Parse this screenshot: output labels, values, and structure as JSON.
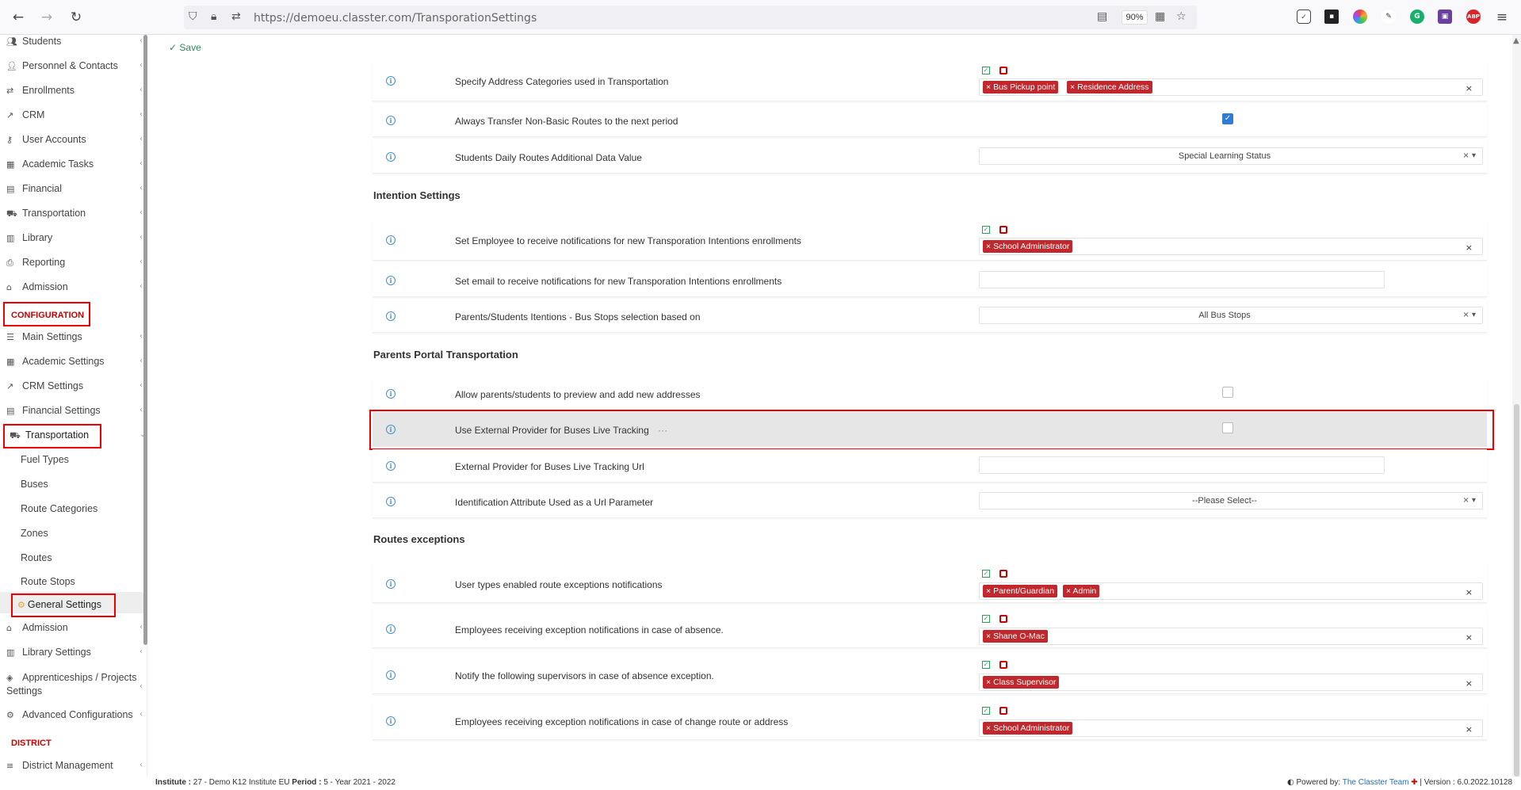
{
  "browser": {
    "url": "https://demoeu.classter.com/TransporationSettings",
    "zoom": "90%"
  },
  "sidebar": {
    "items": [
      {
        "label": "Students",
        "icon": "students-icon"
      },
      {
        "label": "Personnel & Contacts",
        "icon": "personnel-icon"
      },
      {
        "label": "Enrollments",
        "icon": "enrollments-icon"
      },
      {
        "label": "CRM",
        "icon": "crm-icon"
      },
      {
        "label": "User Accounts",
        "icon": "key-icon"
      },
      {
        "label": "Academic Tasks",
        "icon": "grid-icon"
      },
      {
        "label": "Financial",
        "icon": "financial-icon"
      },
      {
        "label": "Transportation",
        "icon": "bus-icon"
      },
      {
        "label": "Library",
        "icon": "library-icon"
      },
      {
        "label": "Reporting",
        "icon": "printer-icon"
      },
      {
        "label": "Admission",
        "icon": "building-icon"
      }
    ],
    "configuration_label": "CONFIGURATION",
    "config_items": [
      {
        "label": "Main Settings",
        "icon": "sliders-icon"
      },
      {
        "label": "Academic Settings",
        "icon": "academic-icon"
      },
      {
        "label": "CRM Settings",
        "icon": "crm-icon"
      },
      {
        "label": "Financial Settings",
        "icon": "financial-icon"
      },
      {
        "label": "Transportation",
        "icon": "bus-icon"
      }
    ],
    "transport_sub": [
      "Fuel Types",
      "Buses",
      "Route Categories",
      "Zones",
      "Routes",
      "Route Stops",
      "General Settings"
    ],
    "config_items_after": [
      {
        "label": "Admission",
        "icon": "building-icon"
      },
      {
        "label": "Library Settings",
        "icon": "library-icon"
      },
      {
        "label": "Apprenticeships / Projects",
        "label2": "Settings",
        "icon": "apprenticeship-icon"
      },
      {
        "label": "Advanced Configurations",
        "icon": "gears-icon"
      }
    ],
    "district_label": "DISTRICT",
    "district_items": [
      {
        "label": "District Management",
        "icon": "menu-icon"
      }
    ]
  },
  "toolbar": {
    "save_label": "Save"
  },
  "rows_top": [
    {
      "label": "Specify Address Categories used in Transportation",
      "tags": [
        "Bus Pickup point",
        "Residence Address"
      ]
    },
    {
      "label": "Always Transfer Non-Basic Routes to the next period",
      "checked": true
    },
    {
      "label": "Students Daily Routes Additional Data Value",
      "select": "Special Learning Status"
    }
  ],
  "sections": {
    "intention": "Intention Settings",
    "parents_portal": "Parents Portal Transportation",
    "routes_exceptions": "Routes exceptions"
  },
  "rows_intention": [
    {
      "label": "Set Employee to receive notifications for new Transporation Intentions enrollments",
      "tags": [
        "School Administrator"
      ]
    },
    {
      "label": "Set email to receive notifications for new Transporation Intentions enrollments"
    },
    {
      "label": "Parents/Students Itentions - Bus Stops selection based on",
      "select": "All Bus Stops"
    }
  ],
  "rows_parents": [
    {
      "label": "Allow parents/students to preview and add new addresses",
      "checked": false
    },
    {
      "label": "Use External Provider for Buses Live Tracking",
      "checked": false,
      "suffix": "···"
    },
    {
      "label": "External Provider for Buses Live Tracking Url"
    },
    {
      "label": "Identification Attribute Used as a Url Parameter",
      "select": "--Please Select--"
    }
  ],
  "rows_exceptions": [
    {
      "label": "User types enabled route exceptions notifications",
      "tags": [
        "Parent/Guardian",
        "Admin"
      ]
    },
    {
      "label": "Employees receiving exception notifications in case of absence.",
      "tags": [
        "Shane O-Mac"
      ]
    },
    {
      "label": "Notify the following supervisors in case of absence exception.",
      "tags": [
        "Class Supervisor"
      ]
    },
    {
      "label": "Employees receiving exception notifications in case of change route or address",
      "tags": [
        "School Administrator"
      ]
    }
  ],
  "footer": {
    "institute_label": "Institute :",
    "institute_value": "27 - Demo K12 Institute EU",
    "period_label": "Period :",
    "period_value": "5 - Year 2021 - 2022",
    "powered_label": "Powered by:",
    "powered_link": "The Classter Team",
    "version": "| Version : 6.0.2022.10128"
  },
  "colors": {
    "accent_red": "#c0282d",
    "highlight_red": "#e00000",
    "checkbox_blue": "#2f7bd8",
    "save_green": "#2e8b57"
  }
}
